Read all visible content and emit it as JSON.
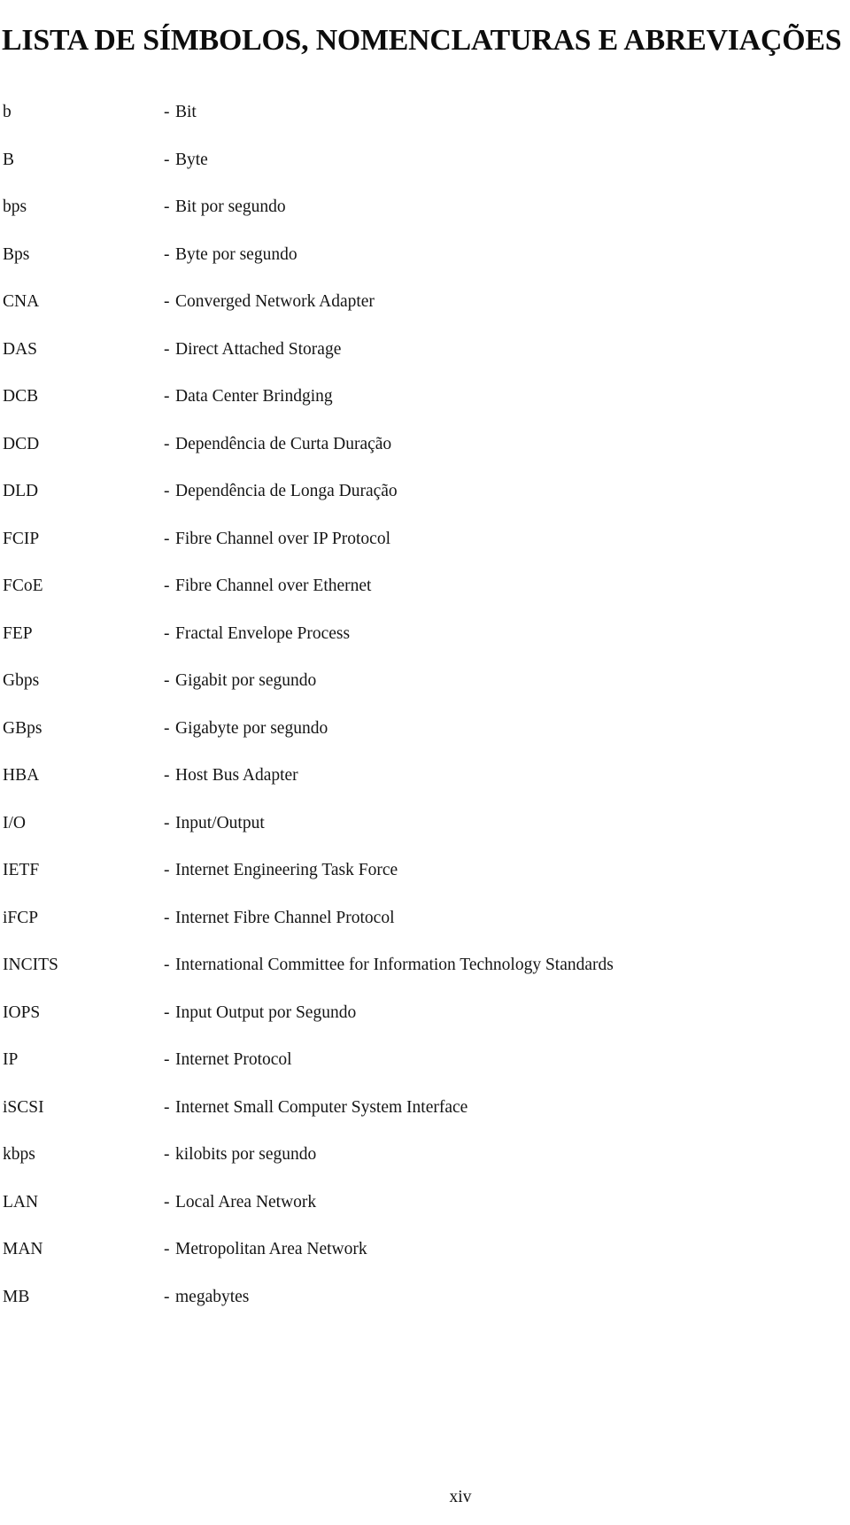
{
  "document": {
    "title": "LISTA DE SÍMBOLOS, NOMENCLATURAS E ABREVIAÇÕES",
    "page_number": "xiv",
    "separator": "-",
    "text_color": "#151515",
    "background_color": "#ffffff"
  },
  "abbreviations": [
    {
      "term": "b",
      "definition": "Bit"
    },
    {
      "term": "B",
      "definition": "Byte"
    },
    {
      "term": "bps",
      "definition": "Bit por segundo"
    },
    {
      "term": "Bps",
      "definition": "Byte por segundo"
    },
    {
      "term": "CNA",
      "definition": "Converged Network Adapter"
    },
    {
      "term": "DAS",
      "definition": "Direct Attached Storage"
    },
    {
      "term": "DCB",
      "definition": "Data Center Brindging"
    },
    {
      "term": "DCD",
      "definition": "Dependência de Curta Duração"
    },
    {
      "term": "DLD",
      "definition": "Dependência de Longa Duração"
    },
    {
      "term": "FCIP",
      "definition": "Fibre Channel over IP Protocol"
    },
    {
      "term": "FCoE",
      "definition": "Fibre Channel over Ethernet"
    },
    {
      "term": "FEP",
      "definition": "Fractal Envelope Process"
    },
    {
      "term": "Gbps",
      "definition": "Gigabit por segundo"
    },
    {
      "term": "GBps",
      "definition": "Gigabyte por segundo"
    },
    {
      "term": "HBA",
      "definition": "Host Bus Adapter"
    },
    {
      "term": "I/O",
      "definition": "Input/Output"
    },
    {
      "term": "IETF",
      "definition": "Internet Engineering Task Force"
    },
    {
      "term": "iFCP",
      "definition": "Internet Fibre Channel Protocol"
    },
    {
      "term": "INCITS",
      "definition": "International Committee for Information Technology Standards"
    },
    {
      "term": "IOPS",
      "definition": "Input Output por Segundo"
    },
    {
      "term": "IP",
      "definition": "Internet Protocol"
    },
    {
      "term": "iSCSI",
      "definition": "Internet Small Computer System Interface"
    },
    {
      "term": "kbps",
      "definition": "kilobits por segundo"
    },
    {
      "term": "LAN",
      "definition": "Local Area Network"
    },
    {
      "term": "MAN",
      "definition": "Metropolitan Area Network"
    },
    {
      "term": "MB",
      "definition": "megabytes"
    }
  ]
}
